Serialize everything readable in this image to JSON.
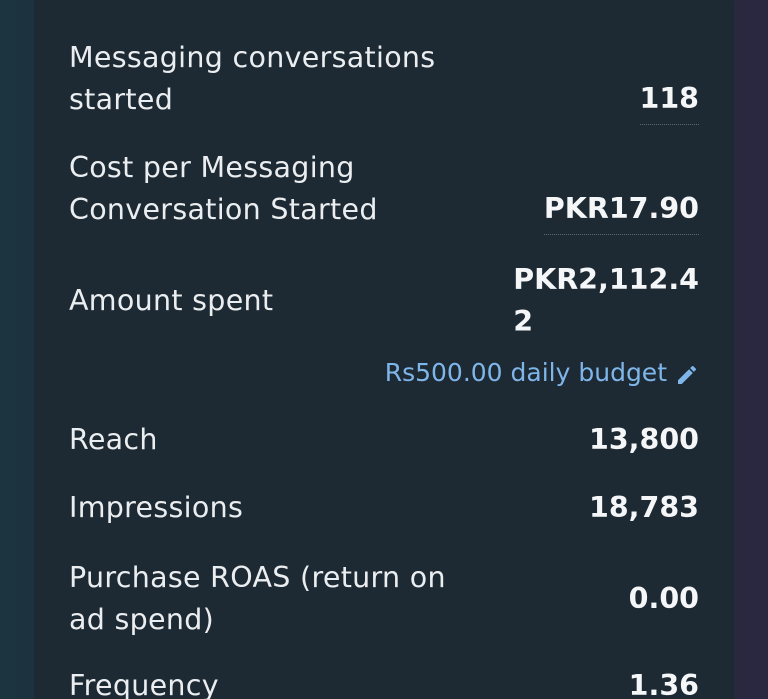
{
  "metrics": {
    "messaging_conversations": {
      "label_line1": "Messaging conversations",
      "label_line2": "started",
      "value": "118"
    },
    "cost_per_messaging": {
      "label_line1": "Cost per Messaging",
      "label_line2": "Conversation Started",
      "value": "PKR17.90"
    },
    "amount_spent": {
      "label": "Amount spent",
      "value_line1": "PKR2,112.4",
      "value_line2": "2",
      "budget": "Rs500.00 daily budget",
      "edit_icon": "pencil-icon"
    },
    "reach": {
      "label": "Reach",
      "value": "13,800"
    },
    "impressions": {
      "label": "Impressions",
      "value": "18,783"
    },
    "purchase_roas": {
      "label_line1": "Purchase ROAS (return on",
      "label_line2": "ad spend)",
      "value": "0.00"
    },
    "frequency": {
      "label": "Frequency",
      "value": "1.36"
    }
  },
  "colors": {
    "card_background": "#1e2a33",
    "link_blue": "#7fb6ea",
    "text_primary": "#ebeef0"
  }
}
